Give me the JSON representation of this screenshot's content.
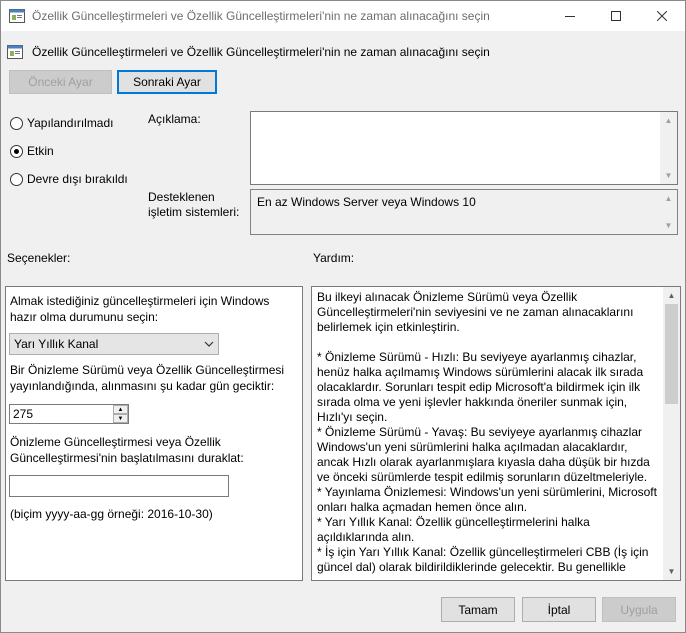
{
  "window": {
    "title": "Özellik Güncelleştirmeleri ve Özellik Güncelleştirmeleri'nin ne zaman alınacağını seçin",
    "header": "Özellik Güncelleştirmeleri ve Özellik Güncelleştirmeleri'nin ne zaman alınacağını seçin"
  },
  "nav": {
    "prev_label": "Önceki Ayar",
    "next_label": "Sonraki Ayar"
  },
  "state": {
    "options": [
      {
        "label": "Yapılandırılmadı",
        "checked": false
      },
      {
        "label": "Etkin",
        "checked": true
      },
      {
        "label": "Devre dışı bırakıldı",
        "checked": false
      }
    ]
  },
  "description": {
    "label": "Açıklama:",
    "value": ""
  },
  "supported": {
    "label_line1": "Desteklenen",
    "label_line2": "işletim sistemleri:",
    "value": "En az Windows Server veya Windows 10"
  },
  "sections": {
    "options_label": "Seçenekler:",
    "help_label": "Yardım:"
  },
  "options": {
    "channel_prompt": "Almak istediğiniz güncelleştirmeleri için Windows hazır olma durumunu seçin:",
    "channel_value": "Yarı Yıllık Kanal",
    "defer_prompt": "Bir Önizleme Sürümü veya Özellik Güncelleştirmesi yayınlandığında, alınmasını şu kadar gün geciktir:",
    "defer_value": "275",
    "pause_prompt": "Önizleme Güncelleştirmesi veya Özellik Güncelleştirmesi'nin başlatılmasını duraklat:",
    "pause_value": "",
    "date_hint": "(biçim yyyy-aa-gg örneği: 2016-10-30)"
  },
  "help": {
    "paragraphs": [
      "Bu ilkeyi alınacak Önizleme Sürümü veya Özellik Güncelleştirmeleri'nin seviyesini ve ne zaman alınacaklarını belirlemek için etkinleştirin.",
      "* Önizleme Sürümü - Hızlı: Bu seviyeye ayarlanmış cihazlar, henüz halka açılmamış Windows sürümlerini alacak ilk sırada olacaklardır. Sorunları tespit edip Microsoft'a bildirmek için ilk sırada olma ve yeni işlevler hakkında öneriler sunmak için, Hızlı'yı seçin.",
      "* Önizleme Sürümü - Yavaş: Bu seviyeye ayarlanmış cihazlar Windows'un yeni sürümlerini halka açılmadan alacaklardır, ancak Hızlı olarak ayarlanmışlara kıyasla daha düşük bir hızda ve önceki sürümlerde tespit edilmiş sorunların düzeltmeleriyle.",
      "* Yayınlama Önizlemesi: Windows'un yeni sürümlerini, Microsoft onları halka açmadan hemen önce alın.",
      "* Yarı Yıllık Kanal: Özellik güncelleştirmelerini halka açıldıklarında alın.",
      "* İş için Yarı Yıllık Kanal: Özellik güncelleştirmeleri CBB (İş için güncel dal) olarak bildirildiklerinde gelecektir. Bu genellikle"
    ]
  },
  "footer": {
    "ok_label": "Tamam",
    "cancel_label": "İptal",
    "apply_label": "Uygula"
  }
}
